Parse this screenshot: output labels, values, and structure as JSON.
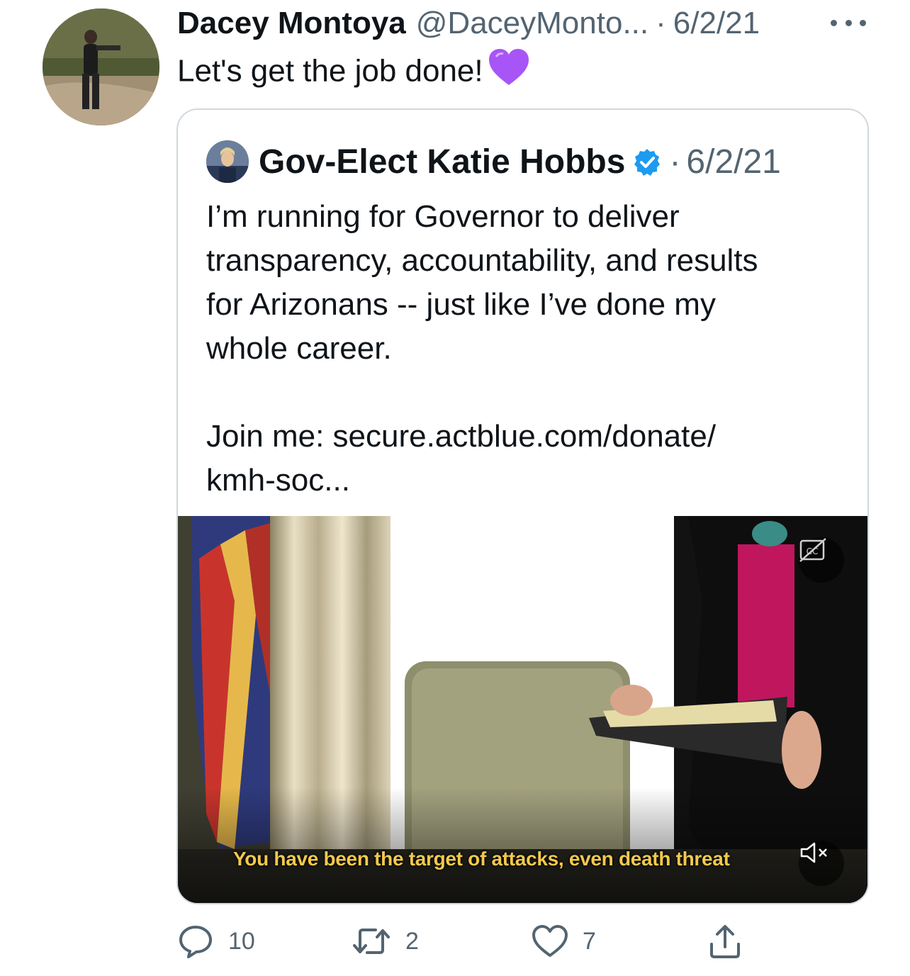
{
  "tweet": {
    "author_name": "Dacey Montoya",
    "handle": "@DaceyMonto...",
    "separator": "·",
    "date": "6/2/21",
    "text": "Let's get the job done!",
    "emoji": "purple-heart"
  },
  "quote": {
    "author_name": "Gov-Elect Katie Hobbs",
    "verified": true,
    "separator": "·",
    "date": "6/2/21",
    "body_lines": [
      "I’m running for Governor to deliver",
      "transparency, accountability, and results",
      "for Arizonans -- just like I’ve done my",
      "whole career."
    ],
    "link_lines": [
      "Join me: secure.actblue.com/donate/",
      "kmh-soc..."
    ],
    "video": {
      "caption": "You have been the target of attacks, even death threat",
      "cc_icon": "closed-captions-off-icon",
      "mute_icon": "muted-speaker-icon"
    }
  },
  "actions": {
    "reply_count": "10",
    "retweet_count": "2",
    "like_count": "7"
  },
  "colors": {
    "text": "#0f1419",
    "secondary": "#536471",
    "border": "#cfd9de",
    "verified": "#1d9bf0",
    "caption": "#f2c94c",
    "emoji": "#a855f7"
  }
}
